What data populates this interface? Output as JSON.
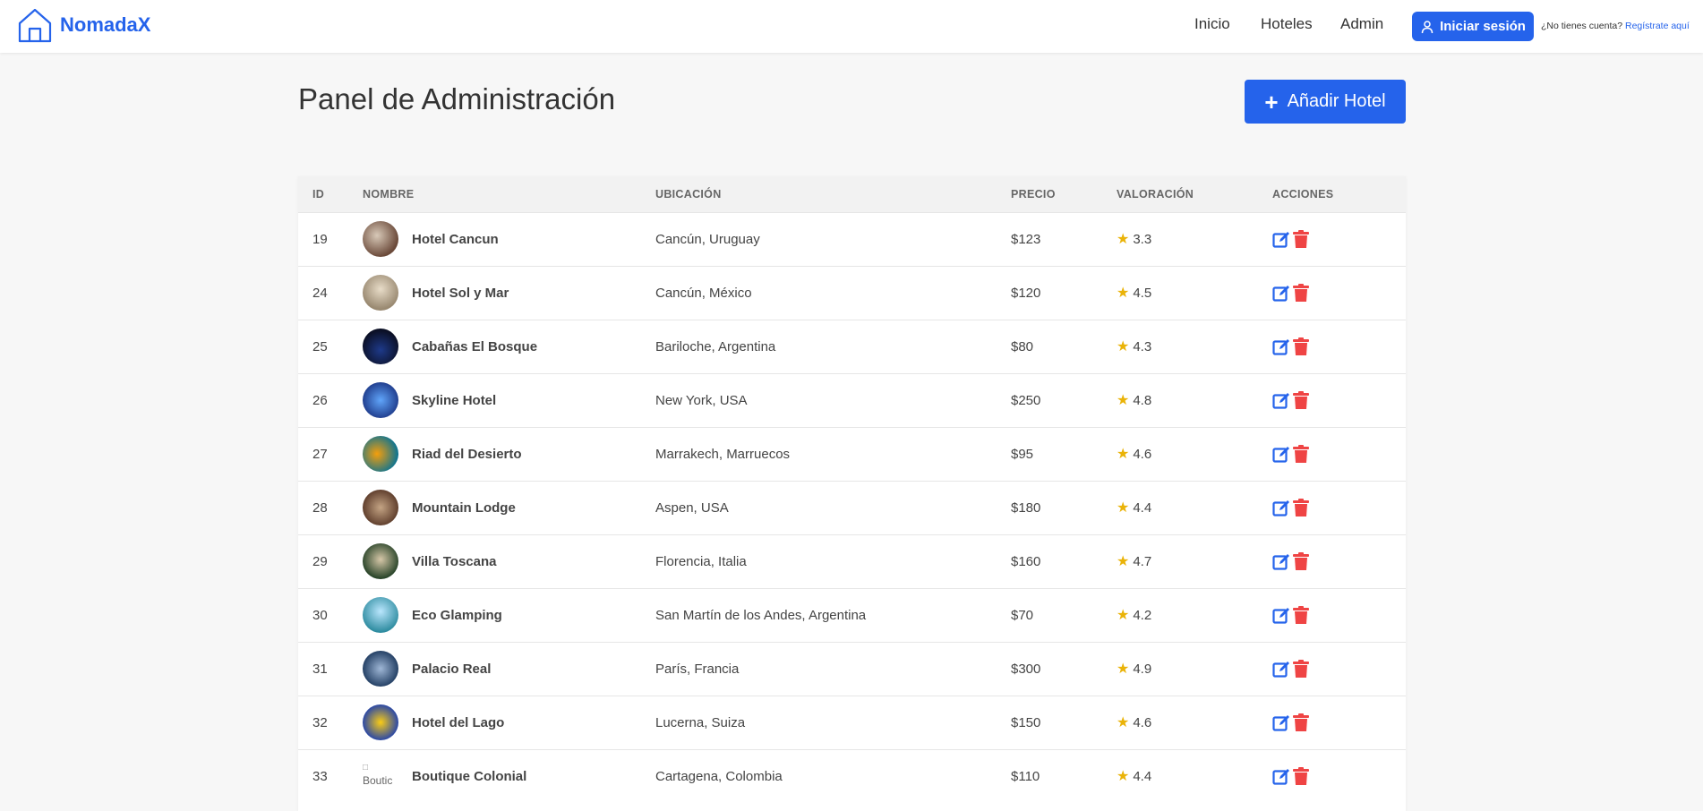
{
  "brand": {
    "name": "NomadaX"
  },
  "nav": {
    "home": "Inicio",
    "hotels": "Hoteles",
    "admin": "Admin"
  },
  "auth": {
    "login_label": "Iniciar sesión",
    "signup_prompt": "¿No tienes cuenta?",
    "signup_link": "Regístrate aquí"
  },
  "page": {
    "title": "Panel de Administración",
    "add_button": "Añadir Hotel"
  },
  "colors": {
    "accent": "#2563eb",
    "delete": "#ef4444",
    "star": "#eab308",
    "background": "#f7f7f7"
  },
  "table": {
    "headers": [
      "ID",
      "NOMBRE",
      "UBICACIÓN",
      "PRECIO",
      "VALORACIÓN",
      "ACCIONES"
    ],
    "rows": [
      {
        "id": "19",
        "name": "Hotel Cancun",
        "location": "Cancún, Uruguay",
        "price": "$123",
        "rating": "3.3"
      },
      {
        "id": "24",
        "name": "Hotel Sol y Mar",
        "location": "Cancún, México",
        "price": "$120",
        "rating": "4.5"
      },
      {
        "id": "25",
        "name": "Cabañas El Bosque",
        "location": "Bariloche, Argentina",
        "price": "$80",
        "rating": "4.3"
      },
      {
        "id": "26",
        "name": "Skyline Hotel",
        "location": "New York, USA",
        "price": "$250",
        "rating": "4.8"
      },
      {
        "id": "27",
        "name": "Riad del Desierto",
        "location": "Marrakech, Marruecos",
        "price": "$95",
        "rating": "4.6"
      },
      {
        "id": "28",
        "name": "Mountain Lodge",
        "location": "Aspen, USA",
        "price": "$180",
        "rating": "4.4"
      },
      {
        "id": "29",
        "name": "Villa Toscana",
        "location": "Florencia, Italia",
        "price": "$160",
        "rating": "4.7"
      },
      {
        "id": "30",
        "name": "Eco Glamping",
        "location": "San Martín de los Andes, Argentina",
        "price": "$70",
        "rating": "4.2"
      },
      {
        "id": "31",
        "name": "Palacio Real",
        "location": "París, Francia",
        "price": "$300",
        "rating": "4.9"
      },
      {
        "id": "32",
        "name": "Hotel del Lago",
        "location": "Lucerna, Suiza",
        "price": "$150",
        "rating": "4.6"
      },
      {
        "id": "33",
        "name": "Boutique Colonial",
        "location": "Cartagena, Colombia",
        "price": "$110",
        "rating": "4.4",
        "broken_image_alt": "Boutic"
      }
    ]
  }
}
